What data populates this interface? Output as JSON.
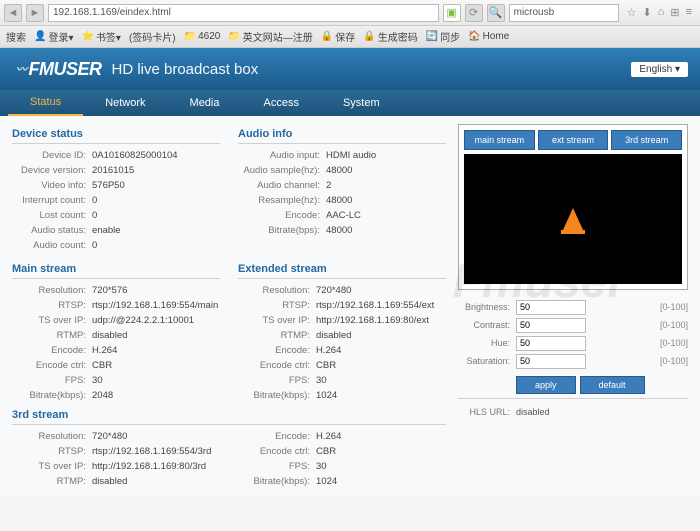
{
  "browser": {
    "url": "192.168.1.169/eindex.html",
    "search": "microusb"
  },
  "bookmarks": [
    "搜索",
    "登录▾",
    "书签▾",
    "(签码卡片)",
    "4620",
    "英文网站—注册",
    "保存",
    "生成密码",
    "同步",
    "Home"
  ],
  "header": {
    "logo": "FMUSER",
    "title": "HD live broadcast box",
    "lang": "English ▾"
  },
  "tabs": [
    "Status",
    "Network",
    "Media",
    "Access",
    "System"
  ],
  "device_status": {
    "title": "Device status",
    "rows": [
      {
        "l": "Device ID:",
        "v": "0A10160825000104"
      },
      {
        "l": "Device version:",
        "v": "20161015"
      },
      {
        "l": "Video info:",
        "v": "576P50"
      },
      {
        "l": "Interrupt count:",
        "v": "0"
      },
      {
        "l": "Lost count:",
        "v": "0"
      },
      {
        "l": "Audio status:",
        "v": "enable"
      },
      {
        "l": "Audio count:",
        "v": "0"
      }
    ]
  },
  "audio_info": {
    "title": "Audio info",
    "rows": [
      {
        "l": "Audio input:",
        "v": "HDMI audio"
      },
      {
        "l": "Audio sample(hz):",
        "v": "48000"
      },
      {
        "l": "Audio channel:",
        "v": "2"
      },
      {
        "l": "Resample(hz):",
        "v": "48000"
      },
      {
        "l": "Encode:",
        "v": "AAC-LC"
      },
      {
        "l": "Bitrate(bps):",
        "v": "48000"
      }
    ]
  },
  "main_stream": {
    "title": "Main stream",
    "rows": [
      {
        "l": "Resolution:",
        "v": "720*576"
      },
      {
        "l": "RTSP:",
        "v": "rtsp://192.168.1.169:554/main"
      },
      {
        "l": "TS over IP:",
        "v": "udp://@224.2.2.1:10001"
      },
      {
        "l": "RTMP:",
        "v": "disabled"
      },
      {
        "l": "Encode:",
        "v": "H.264"
      },
      {
        "l": "Encode ctrl:",
        "v": "CBR"
      },
      {
        "l": "FPS:",
        "v": "30"
      },
      {
        "l": "Bitrate(kbps):",
        "v": "2048"
      }
    ]
  },
  "ext_stream": {
    "title": "Extended stream",
    "rows": [
      {
        "l": "Resolution:",
        "v": "720*480"
      },
      {
        "l": "RTSP:",
        "v": "rtsp://192.168.1.169:554/ext"
      },
      {
        "l": "TS over IP:",
        "v": "http://192.168.1.169:80/ext"
      },
      {
        "l": "RTMP:",
        "v": "disabled"
      },
      {
        "l": "Encode:",
        "v": "H.264"
      },
      {
        "l": "Encode ctrl:",
        "v": "CBR"
      },
      {
        "l": "FPS:",
        "v": "30"
      },
      {
        "l": "Bitrate(kbps):",
        "v": "1024"
      }
    ]
  },
  "third_stream": {
    "title": "3rd stream",
    "left_rows": [
      {
        "l": "Resolution:",
        "v": "720*480"
      },
      {
        "l": "RTSP:",
        "v": "rtsp://192.168.1.169:554/3rd"
      },
      {
        "l": "TS over IP:",
        "v": "http://192.168.1.169:80/3rd"
      },
      {
        "l": "RTMP:",
        "v": "disabled"
      }
    ],
    "right_rows": [
      {
        "l": "Encode:",
        "v": "H.264"
      },
      {
        "l": "Encode ctrl:",
        "v": "CBR"
      },
      {
        "l": "FPS:",
        "v": "30"
      },
      {
        "l": "Bitrate(kbps):",
        "v": "1024"
      }
    ]
  },
  "stream_tabs": [
    "main stream",
    "ext stream",
    "3rd stream"
  ],
  "controls": [
    {
      "l": "Brightness:",
      "v": "50",
      "r": "[0-100]"
    },
    {
      "l": "Contrast:",
      "v": "50",
      "r": "[0-100]"
    },
    {
      "l": "Hue:",
      "v": "50",
      "r": "[0-100]"
    },
    {
      "l": "Saturation:",
      "v": "50",
      "r": "[0-100]"
    }
  ],
  "buttons": {
    "apply": "apply",
    "default": "default"
  },
  "hls": {
    "l": "HLS URL:",
    "v": "disabled"
  },
  "watermark": "Fmuser"
}
